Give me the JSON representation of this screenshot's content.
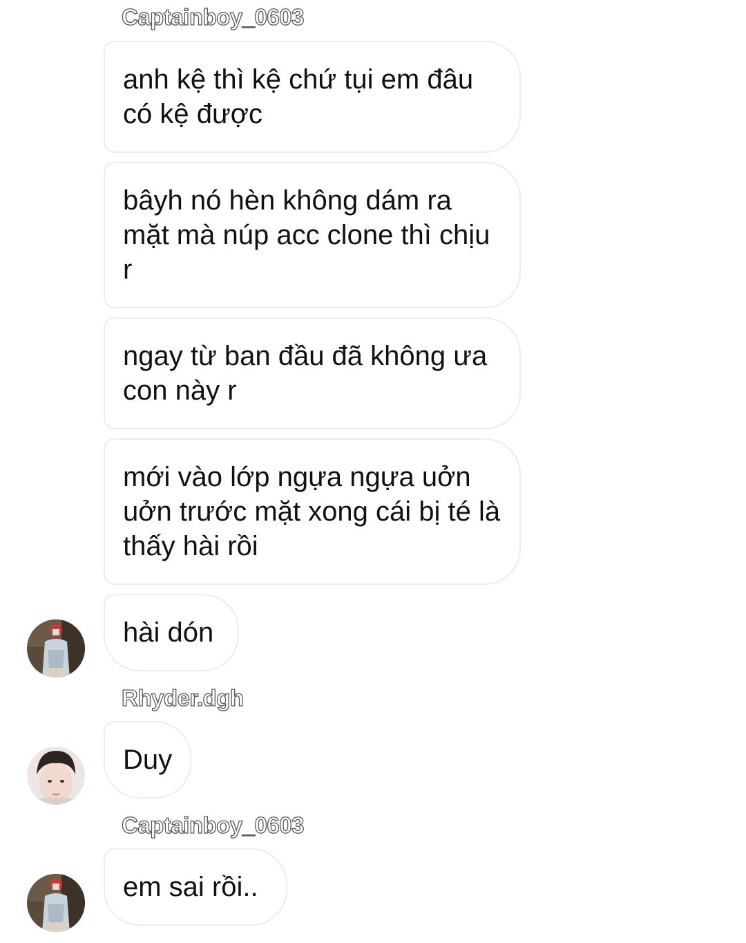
{
  "messages": [
    {
      "sender": "Captainboy_0603",
      "text": "anh kệ thì kệ chứ tụi em đâu có kệ được"
    },
    {
      "text": "bâyh nó hèn không dám ra mặt mà núp acc clone thì chịu r"
    },
    {
      "text": "ngay từ ban đầu đã không ưa con này r"
    },
    {
      "text": "mới vào lớp ngựa ngựa uởn uởn trước mặt xong cái bị té là thấy hài rồi"
    },
    {
      "text": "hài dón",
      "avatar": "captainboy-avatar"
    },
    {
      "sender": "Rhyder.dgh",
      "text": "Duy",
      "avatar": "rhyder-avatar"
    },
    {
      "sender": "Captainboy_0603",
      "text": "em sai rồi..",
      "avatar": "captainboy-avatar"
    }
  ],
  "colors": {
    "bubble_border": "#ececec",
    "text": "#111111",
    "sender_outline": "#555555",
    "background": "#ffffff"
  }
}
